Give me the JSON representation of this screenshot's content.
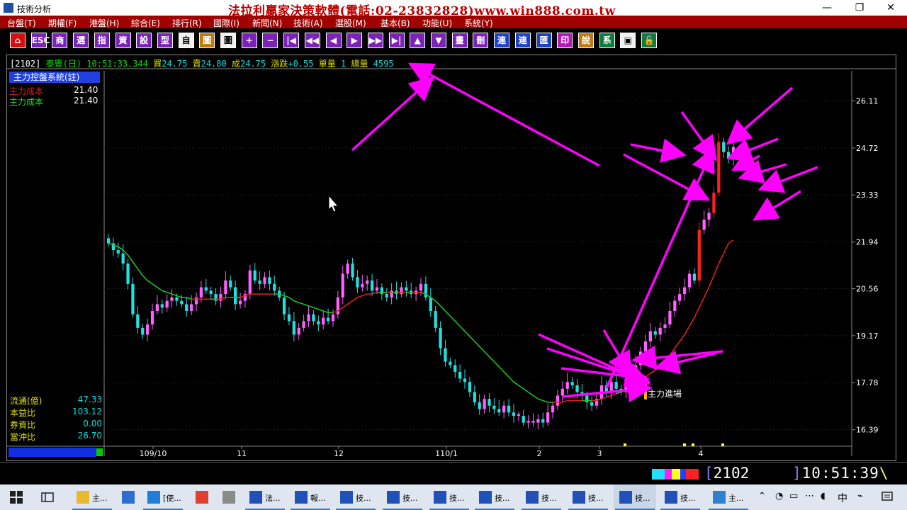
{
  "window": {
    "title": "技術分析",
    "promo_banner": "法拉利贏家決策軟體(電話:02-23832828)www.win888.com.tw",
    "min_glyph": "—",
    "restore_glyph": "❐",
    "close_glyph": "✕"
  },
  "menu": [
    "台盤(T)",
    "期權(F)",
    "港盤(H)",
    "綜合(E)",
    "排行(R)",
    "國際(I)",
    "新聞(N)",
    "技術(A)",
    "選股(M)",
    "基本(B)",
    "功能(U)",
    "系統(Y)"
  ],
  "toolbar": [
    {
      "label": "⌂",
      "color": "red"
    },
    {
      "label": "ESC",
      "color": "purple"
    },
    {
      "label": "商",
      "color": "purple"
    },
    {
      "label": "選",
      "color": "purple"
    },
    {
      "label": "指",
      "color": "purple"
    },
    {
      "label": "資",
      "color": "purple"
    },
    {
      "label": "設",
      "color": "purple"
    },
    {
      "label": "型",
      "color": "purple"
    },
    {
      "label": "自",
      "color": "white"
    },
    {
      "label": "圖",
      "color": "orange"
    },
    {
      "label": "圖",
      "color": "white"
    },
    {
      "label": "+",
      "color": "purple"
    },
    {
      "label": "−",
      "color": "purple"
    },
    {
      "label": "|◀",
      "color": "purple"
    },
    {
      "label": "◀◀",
      "color": "purple"
    },
    {
      "label": "◀",
      "color": "purple"
    },
    {
      "label": "▶",
      "color": "purple"
    },
    {
      "label": "▶▶",
      "color": "purple"
    },
    {
      "label": "▶|",
      "color": "purple"
    },
    {
      "label": "▲",
      "color": "purple"
    },
    {
      "label": "▼",
      "color": "purple"
    },
    {
      "label": "畫",
      "color": "purple"
    },
    {
      "label": "刪",
      "color": "purple"
    },
    {
      "label": "連",
      "color": "blue"
    },
    {
      "label": "連",
      "color": "blue"
    },
    {
      "label": "匯",
      "color": "blue"
    },
    {
      "label": "印",
      "color": "magenta"
    },
    {
      "label": "說",
      "color": "orange"
    },
    {
      "label": "系",
      "color": "green"
    },
    {
      "label": "▣",
      "color": "white"
    },
    {
      "label": "🔓",
      "color": "green"
    }
  ],
  "quote": {
    "code": "[2102]",
    "name": "泰豐(日)",
    "time": "10:51:33.344",
    "buy_label": "買",
    "buy": "24.75",
    "sell_label": "賣",
    "sell": "24.80",
    "deal_label": "成",
    "deal": "24.75",
    "change_label": "漲跌",
    "change": "+0.55",
    "unit_label": "單量",
    "unit": "1",
    "total_label": "總量",
    "total": "4595"
  },
  "indicator_panel": {
    "title": "主力控盤系統(註)",
    "rows": [
      {
        "label": "主力成本",
        "value": "21.40",
        "color": "#e02020"
      },
      {
        "label": "主力成本",
        "value": "21.40",
        "color": "#20e020"
      }
    ]
  },
  "stats": [
    {
      "label": "流通(億)",
      "value": "47.33"
    },
    {
      "label": "本益比",
      "value": "103.12"
    },
    {
      "label": "券資比",
      "value": "0.00"
    },
    {
      "label": "當沖比",
      "value": "26.70"
    }
  ],
  "chart_data": {
    "type": "candlestick",
    "price_ticks": [
      "26.11",
      "24.72",
      "23.33",
      "21.94",
      "20.56",
      "19.17",
      "17.78",
      "16.39"
    ],
    "price_range": [
      15.9,
      27.0
    ],
    "x_ticks": [
      "109/10",
      "11",
      "12",
      "110/1",
      "2",
      "3",
      "4"
    ],
    "annotation": "主力進場",
    "colors": {
      "up": "#ff60ff",
      "down": "#20e0e0",
      "strong_up": "#ff2020",
      "ma": "#20c020",
      "ma_above": "#e02020",
      "arrows": "#ff00ff"
    },
    "closes": [
      21.9,
      21.7,
      21.6,
      21.3,
      20.7,
      19.8,
      19.4,
      19.2,
      19.5,
      19.9,
      20.1,
      20.0,
      20.2,
      20.3,
      20.2,
      20.1,
      19.9,
      20.1,
      20.3,
      20.6,
      20.5,
      20.4,
      20.2,
      20.4,
      20.8,
      20.6,
      20.1,
      20.2,
      20.4,
      21.1,
      20.8,
      20.7,
      20.9,
      20.7,
      20.5,
      20.3,
      19.8,
      19.6,
      19.2,
      19.4,
      19.6,
      19.8,
      19.6,
      19.5,
      19.7,
      19.6,
      19.8,
      20.3,
      21.0,
      21.3,
      20.9,
      20.6,
      20.7,
      20.8,
      20.5,
      20.6,
      20.4,
      20.3,
      20.5,
      20.4,
      20.6,
      20.5,
      20.4,
      20.5,
      20.7,
      20.3,
      19.9,
      19.4,
      18.8,
      18.4,
      18.3,
      18.1,
      17.9,
      17.8,
      17.5,
      17.2,
      17.0,
      17.3,
      17.1,
      17.0,
      16.9,
      17.1,
      16.9,
      16.8,
      16.8,
      16.6,
      16.6,
      16.6,
      16.7,
      16.6,
      16.9,
      17.1,
      17.4,
      17.6,
      17.8,
      17.7,
      17.5,
      17.4,
      17.2,
      17.1,
      17.3,
      17.7,
      17.5,
      17.8,
      17.6,
      17.5,
      17.9,
      18.2,
      18.3,
      18.7,
      19.0,
      19.3,
      19.2,
      19.4,
      19.5,
      19.9,
      20.2,
      20.4,
      20.6,
      21.0,
      20.8,
      22.3,
      22.6,
      22.8,
      23.4,
      24.9,
      24.6,
      24.4,
      24.75
    ],
    "ma": [
      21.9,
      21.85,
      21.8,
      21.7,
      21.55,
      21.35,
      21.15,
      20.95,
      20.8,
      20.7,
      20.6,
      20.5,
      20.45,
      20.4,
      20.35,
      20.3,
      20.3,
      20.25,
      20.25,
      20.25,
      20.25,
      20.25,
      20.25,
      20.25,
      20.3,
      20.3,
      20.3,
      20.3,
      20.35,
      20.4,
      20.4,
      20.4,
      20.4,
      20.4,
      20.4,
      20.4,
      20.35,
      20.3,
      20.2,
      20.15,
      20.1,
      20.05,
      20.0,
      19.95,
      19.9,
      19.85,
      19.85,
      19.9,
      20.0,
      20.1,
      20.2,
      20.3,
      20.35,
      20.4,
      20.4,
      20.45,
      20.45,
      20.45,
      20.45,
      20.45,
      20.45,
      20.45,
      20.45,
      20.45,
      20.45,
      20.4,
      20.3,
      20.2,
      20.05,
      19.9,
      19.75,
      19.6,
      19.45,
      19.3,
      19.15,
      19.0,
      18.85,
      18.7,
      18.55,
      18.4,
      18.25,
      18.1,
      17.95,
      17.8,
      17.7,
      17.6,
      17.5,
      17.4,
      17.3,
      17.25,
      17.2,
      17.2,
      17.2,
      17.2,
      17.25,
      17.25,
      17.25,
      17.25,
      17.25,
      17.25,
      17.25,
      17.3,
      17.35,
      17.4,
      17.45,
      17.5,
      17.55,
      17.65,
      17.75,
      17.85,
      17.95,
      18.05,
      18.15,
      18.3,
      18.45,
      18.6,
      18.8,
      19.0,
      19.2,
      19.45,
      19.7,
      20.0,
      20.3,
      20.6,
      20.95,
      21.3,
      21.6,
      21.9,
      22.0
    ],
    "ma_end_index": 128
  },
  "status": {
    "code": "2102",
    "clock": "10:51:39"
  },
  "taskbar": {
    "items": [
      {
        "label": "主...",
        "icon": "folder-icon",
        "color": "#e8b830"
      },
      {
        "label": "",
        "icon": "app-icon",
        "color": "#2d6fd0"
      },
      {
        "label": "[使...",
        "icon": "ie-icon",
        "color": "#1f7fd8"
      },
      {
        "label": "",
        "icon": "chrome-icon",
        "color": "#e04030"
      },
      {
        "label": "",
        "icon": "tool-icon",
        "color": "#8a8a8a"
      },
      {
        "label": "法...",
        "icon": "app-icon",
        "color": "#2050b8"
      },
      {
        "label": "報...",
        "icon": "chart-app-icon",
        "color": "#2050b8"
      },
      {
        "label": "技...",
        "icon": "chart-app-icon",
        "color": "#2050b8"
      },
      {
        "label": "技...",
        "icon": "chart-app-icon",
        "color": "#2050b8"
      },
      {
        "label": "技...",
        "icon": "chart-app-icon",
        "color": "#2050b8"
      },
      {
        "label": "技...",
        "icon": "chart-app-icon",
        "color": "#2050b8"
      },
      {
        "label": "技...",
        "icon": "chart-app-icon",
        "color": "#2050b8"
      },
      {
        "label": "技...",
        "icon": "chart-app-icon",
        "color": "#2050b8"
      },
      {
        "label": "技...",
        "icon": "chart-app-icon",
        "color": "#2050b8"
      },
      {
        "label": "技...",
        "icon": "chart-app-icon",
        "color": "#2050b8"
      },
      {
        "label": "主...",
        "icon": "image-app-icon",
        "color": "#3080d0"
      }
    ],
    "tray_ime": "中",
    "tray_symbols": [
      "⌃",
      "◔",
      "▭",
      "◖",
      "⋯",
      "⌁"
    ]
  }
}
